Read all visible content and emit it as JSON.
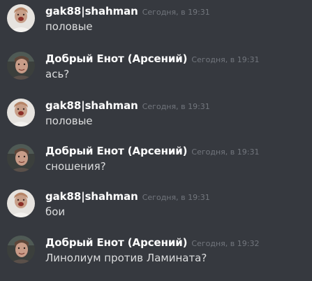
{
  "messages": [
    {
      "author": "gak88|shahman",
      "timestamp": "Сегодня, в 19:31",
      "text": "половые",
      "avatar": "avatar-light"
    },
    {
      "author": "Добрый Енот (Арсений)",
      "timestamp": "Сегодня, в 19:31",
      "text": "ась?",
      "avatar": "avatar-dark"
    },
    {
      "author": "gak88|shahman",
      "timestamp": "Сегодня, в 19:31",
      "text": "половые",
      "avatar": "avatar-light"
    },
    {
      "author": "Добрый Енот (Арсений)",
      "timestamp": "Сегодня, в 19:31",
      "text": "сношения?",
      "avatar": "avatar-dark"
    },
    {
      "author": "gak88|shahman",
      "timestamp": "Сегодня, в 19:31",
      "text": "бои",
      "avatar": "avatar-light"
    },
    {
      "author": "Добрый Енот (Арсений)",
      "timestamp": "Сегодня, в 19:32",
      "text": "Линолиум против Ламината?",
      "avatar": "avatar-dark"
    }
  ],
  "colors": {
    "background": "#36393f",
    "username": "#ffffff",
    "timestamp": "#72767d",
    "message_text": "#dcddde"
  }
}
